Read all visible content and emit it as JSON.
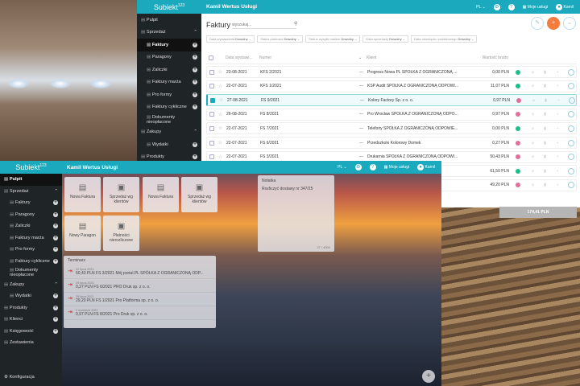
{
  "back": {
    "logo": "Subiekt",
    "logo_sup": "123",
    "company": "Kamil Wertus Usługi",
    "lang": "PL",
    "services": "Moje usługi",
    "user": "Kamil",
    "sidebar": [
      {
        "label": "Pulpit",
        "sub": false
      },
      {
        "label": "Sprzedaż",
        "sub": false,
        "toggle": "^"
      },
      {
        "label": "Faktury",
        "sub": true,
        "plus": true,
        "active": true
      },
      {
        "label": "Paragony",
        "sub": true,
        "plus": true
      },
      {
        "label": "Zaliczki",
        "sub": true,
        "plus": true
      },
      {
        "label": "Faktury marża",
        "sub": true,
        "plus": true
      },
      {
        "label": "Pro formy",
        "sub": true,
        "plus": true
      },
      {
        "label": "Faktury cykliczne",
        "sub": true,
        "plus": true
      },
      {
        "label": "Dokumenty nieopłacone",
        "sub": true
      },
      {
        "label": "Zakupy",
        "sub": false,
        "toggle": "^"
      },
      {
        "label": "Wydatki",
        "sub": true,
        "plus": true
      },
      {
        "label": "Produkty",
        "sub": false,
        "plus": true
      },
      {
        "label": "Klienci",
        "sub": false,
        "plus": true
      }
    ],
    "page_title": "Faktury",
    "search_placeholder": "wyszukaj...",
    "filters": [
      {
        "label": "Data wystawienia",
        "value": "Dowolny"
      },
      {
        "label": "Status płatności",
        "value": "Dowolny"
      },
      {
        "label": "Status wysyłki mailem",
        "value": "Dowolny"
      },
      {
        "label": "Data sprzedaży",
        "value": "Dowolny"
      },
      {
        "label": "Data obowiązku podatkowego",
        "value": "Dowolny"
      }
    ],
    "columns": {
      "date": "Data wystawi...",
      "number": "Numer",
      "client": "Klient",
      "amount": "Wartość brutto"
    },
    "rows": [
      {
        "date": "23-08-2021",
        "number": "KFS 2/2021",
        "client": "Progress Nowa PL SPÓŁKA Z OGRANICZONĄ ...",
        "amount": "0,00 PLN",
        "status": "paid"
      },
      {
        "date": "22-07-2021",
        "number": "KFS 1/2021",
        "client": "KSP Audit SPÓŁKA Z OGRANICZONĄ ODPOWI...",
        "amount": "11,07 PLN",
        "status": "paid"
      },
      {
        "date": "27-08-2021",
        "number": "FS 9/2021",
        "client": "Kolory Factory Sp. z o. o.",
        "amount": "0,97 PLN",
        "status": "unpaid",
        "selected": true
      },
      {
        "date": "26-08-2021",
        "number": "FS 8/2021",
        "client": "Pro Wrocław SPÓŁKA Z OGRANICZONĄ ODPO...",
        "amount": "0,97 PLN",
        "status": "unpaid"
      },
      {
        "date": "22-07-2021",
        "number": "FS 7/2021",
        "client": "Telefony SPÓŁKA Z OGRANICZONĄ ODPOWIE...",
        "amount": "0,00 PLN",
        "status": "paid"
      },
      {
        "date": "22-07-2021",
        "number": "FS 6/2021",
        "client": "Przedszkole Kolorowy Domek",
        "amount": "0,27 PLN",
        "status": "unpaid"
      },
      {
        "date": "22-07-2021",
        "number": "FS 3/2021",
        "client": "Drukarnia SPÓŁKA Z OGRANICZONĄ ODPOWI...",
        "amount": "50,43 PLN",
        "status": "unpaid"
      },
      {
        "date": "",
        "number": "",
        "client": "...OWIEDZI...",
        "amount": "61,50 PLN",
        "status": "paid"
      },
      {
        "date": "",
        "number": "",
        "client": "",
        "amount": "49,20 PLN",
        "status": "unpaid"
      }
    ],
    "total": "174,41 PLN"
  },
  "front": {
    "logo": "Subiekt",
    "logo_sup": "123",
    "company": "Kamil Wertus Usługi",
    "lang": "PL",
    "services": "Moje usługi",
    "user": "Kamil",
    "sidebar": [
      {
        "label": "Pulpit",
        "sub": false,
        "active": true
      },
      {
        "label": "Sprzedaż",
        "sub": false,
        "toggle": "^"
      },
      {
        "label": "Faktury",
        "sub": true,
        "plus": true
      },
      {
        "label": "Paragony",
        "sub": true,
        "plus": true
      },
      {
        "label": "Zaliczki",
        "sub": true,
        "plus": true
      },
      {
        "label": "Faktury marża",
        "sub": true,
        "plus": true
      },
      {
        "label": "Pro formy",
        "sub": true,
        "plus": true
      },
      {
        "label": "Faktury cykliczne",
        "sub": true,
        "plus": true
      },
      {
        "label": "Dokumenty nieopłacone",
        "sub": true
      },
      {
        "label": "Zakupy",
        "sub": false,
        "toggle": "^"
      },
      {
        "label": "Wydatki",
        "sub": true,
        "plus": true
      },
      {
        "label": "Produkty",
        "sub": false,
        "plus": true
      },
      {
        "label": "Klienci",
        "sub": false,
        "plus": true
      },
      {
        "label": "Księgowość",
        "sub": false,
        "plus": true
      },
      {
        "label": "Zestawienia",
        "sub": false
      }
    ],
    "config": "Konfiguracja",
    "tiles": [
      "Nowa Faktura",
      "Sprzedaż wg klientów",
      "Nowa Faktura",
      "Sprzedaż wg klientów",
      "Nowy Paragon",
      "Płatności nierozliczone"
    ],
    "terminarz": {
      "title": "Terminarz",
      "items": [
        {
          "date": "22 lipca 2021",
          "text": "50,43 PLN    FS 3/2021 Mój portal.PL SPÓŁKA Z OGRANICZONĄ ODP..."
        },
        {
          "date": "29 lipca 2021",
          "text": "0,27 PLN    FS 6/2021 PRO Druk sp. z o. o."
        },
        {
          "date": "29 lipca 2021",
          "text": "29,20 PLN    FS 1/2021 Pro Platforma sp. z o. o."
        },
        {
          "date": "2 września 2021",
          "text": "0,97 PLN    FS 8/2021 Pro Druk sp. z o. o."
        }
      ]
    },
    "note": {
      "title": "Notatka",
      "text": "Rozliczyć dostawy nr 347/25",
      "counter": "27 / 4000"
    }
  },
  "colors": {
    "teal": "#1aa9bd",
    "paid": "#1bbf8a",
    "unpaid": "#e0709a",
    "orange": "#f47c3c"
  }
}
